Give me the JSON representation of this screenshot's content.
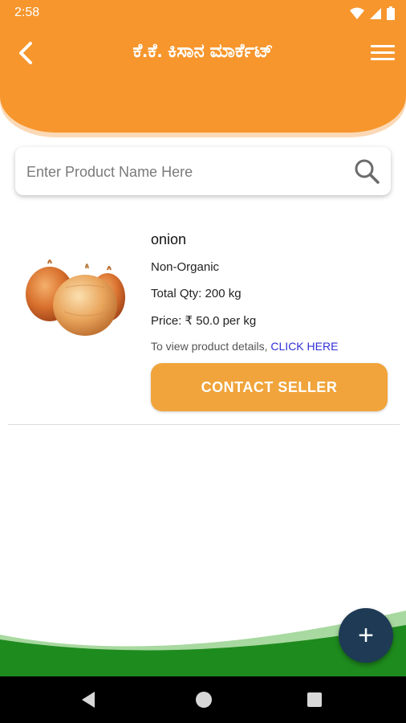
{
  "status_bar": {
    "time": "2:58",
    "icons": [
      "wifi-icon",
      "cell-signal-icon",
      "battery-icon"
    ]
  },
  "app_bar": {
    "title": "ಕೆ.ಕೆ. ಕಿಸಾನ ಮಾರ್ಕೆಟ್",
    "back_icon": "chevron-left-icon",
    "menu_icon": "hamburger-icon"
  },
  "search": {
    "placeholder": "Enter Product Name Here",
    "value": "",
    "icon": "search-icon"
  },
  "products": [
    {
      "name": "onion",
      "type": "Non-Organic",
      "quantity": "Total Qty: 200 kg",
      "price": "Price: ₹ 50.0 per kg",
      "details_prefix": "To view product details, ",
      "details_link": "CLICK HERE",
      "contact_label": "CONTACT SELLER"
    }
  ],
  "fab": {
    "label": "+",
    "icon": "plus-icon"
  },
  "nav_bar": {
    "icons": [
      "nav-back-icon",
      "nav-home-icon",
      "nav-recents-icon"
    ]
  },
  "colors": {
    "primary_orange": "#f6962d",
    "button_orange": "#f0a43b",
    "fab_navy": "#1e3a55",
    "green": "#1e8b1e",
    "link_blue": "#2f2fd8"
  }
}
